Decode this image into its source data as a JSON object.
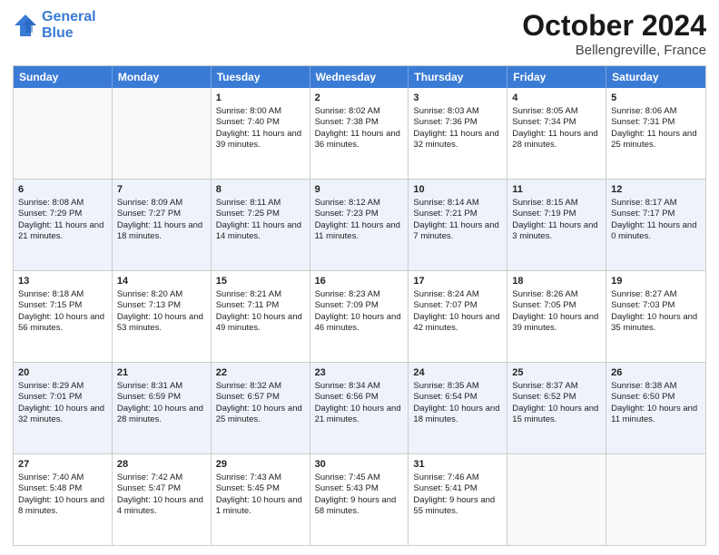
{
  "header": {
    "logo_line1": "General",
    "logo_line2": "Blue",
    "month": "October 2024",
    "location": "Bellengreville, France"
  },
  "weekdays": [
    "Sunday",
    "Monday",
    "Tuesday",
    "Wednesday",
    "Thursday",
    "Friday",
    "Saturday"
  ],
  "rows": [
    [
      {
        "day": "",
        "info": ""
      },
      {
        "day": "",
        "info": ""
      },
      {
        "day": "1",
        "info": "Sunrise: 8:00 AM\nSunset: 7:40 PM\nDaylight: 11 hours and 39 minutes."
      },
      {
        "day": "2",
        "info": "Sunrise: 8:02 AM\nSunset: 7:38 PM\nDaylight: 11 hours and 36 minutes."
      },
      {
        "day": "3",
        "info": "Sunrise: 8:03 AM\nSunset: 7:36 PM\nDaylight: 11 hours and 32 minutes."
      },
      {
        "day": "4",
        "info": "Sunrise: 8:05 AM\nSunset: 7:34 PM\nDaylight: 11 hours and 28 minutes."
      },
      {
        "day": "5",
        "info": "Sunrise: 8:06 AM\nSunset: 7:31 PM\nDaylight: 11 hours and 25 minutes."
      }
    ],
    [
      {
        "day": "6",
        "info": "Sunrise: 8:08 AM\nSunset: 7:29 PM\nDaylight: 11 hours and 21 minutes."
      },
      {
        "day": "7",
        "info": "Sunrise: 8:09 AM\nSunset: 7:27 PM\nDaylight: 11 hours and 18 minutes."
      },
      {
        "day": "8",
        "info": "Sunrise: 8:11 AM\nSunset: 7:25 PM\nDaylight: 11 hours and 14 minutes."
      },
      {
        "day": "9",
        "info": "Sunrise: 8:12 AM\nSunset: 7:23 PM\nDaylight: 11 hours and 11 minutes."
      },
      {
        "day": "10",
        "info": "Sunrise: 8:14 AM\nSunset: 7:21 PM\nDaylight: 11 hours and 7 minutes."
      },
      {
        "day": "11",
        "info": "Sunrise: 8:15 AM\nSunset: 7:19 PM\nDaylight: 11 hours and 3 minutes."
      },
      {
        "day": "12",
        "info": "Sunrise: 8:17 AM\nSunset: 7:17 PM\nDaylight: 11 hours and 0 minutes."
      }
    ],
    [
      {
        "day": "13",
        "info": "Sunrise: 8:18 AM\nSunset: 7:15 PM\nDaylight: 10 hours and 56 minutes."
      },
      {
        "day": "14",
        "info": "Sunrise: 8:20 AM\nSunset: 7:13 PM\nDaylight: 10 hours and 53 minutes."
      },
      {
        "day": "15",
        "info": "Sunrise: 8:21 AM\nSunset: 7:11 PM\nDaylight: 10 hours and 49 minutes."
      },
      {
        "day": "16",
        "info": "Sunrise: 8:23 AM\nSunset: 7:09 PM\nDaylight: 10 hours and 46 minutes."
      },
      {
        "day": "17",
        "info": "Sunrise: 8:24 AM\nSunset: 7:07 PM\nDaylight: 10 hours and 42 minutes."
      },
      {
        "day": "18",
        "info": "Sunrise: 8:26 AM\nSunset: 7:05 PM\nDaylight: 10 hours and 39 minutes."
      },
      {
        "day": "19",
        "info": "Sunrise: 8:27 AM\nSunset: 7:03 PM\nDaylight: 10 hours and 35 minutes."
      }
    ],
    [
      {
        "day": "20",
        "info": "Sunrise: 8:29 AM\nSunset: 7:01 PM\nDaylight: 10 hours and 32 minutes."
      },
      {
        "day": "21",
        "info": "Sunrise: 8:31 AM\nSunset: 6:59 PM\nDaylight: 10 hours and 28 minutes."
      },
      {
        "day": "22",
        "info": "Sunrise: 8:32 AM\nSunset: 6:57 PM\nDaylight: 10 hours and 25 minutes."
      },
      {
        "day": "23",
        "info": "Sunrise: 8:34 AM\nSunset: 6:56 PM\nDaylight: 10 hours and 21 minutes."
      },
      {
        "day": "24",
        "info": "Sunrise: 8:35 AM\nSunset: 6:54 PM\nDaylight: 10 hours and 18 minutes."
      },
      {
        "day": "25",
        "info": "Sunrise: 8:37 AM\nSunset: 6:52 PM\nDaylight: 10 hours and 15 minutes."
      },
      {
        "day": "26",
        "info": "Sunrise: 8:38 AM\nSunset: 6:50 PM\nDaylight: 10 hours and 11 minutes."
      }
    ],
    [
      {
        "day": "27",
        "info": "Sunrise: 7:40 AM\nSunset: 5:48 PM\nDaylight: 10 hours and 8 minutes."
      },
      {
        "day": "28",
        "info": "Sunrise: 7:42 AM\nSunset: 5:47 PM\nDaylight: 10 hours and 4 minutes."
      },
      {
        "day": "29",
        "info": "Sunrise: 7:43 AM\nSunset: 5:45 PM\nDaylight: 10 hours and 1 minute."
      },
      {
        "day": "30",
        "info": "Sunrise: 7:45 AM\nSunset: 5:43 PM\nDaylight: 9 hours and 58 minutes."
      },
      {
        "day": "31",
        "info": "Sunrise: 7:46 AM\nSunset: 5:41 PM\nDaylight: 9 hours and 55 minutes."
      },
      {
        "day": "",
        "info": ""
      },
      {
        "day": "",
        "info": ""
      }
    ]
  ],
  "alt_rows": [
    1,
    3
  ]
}
